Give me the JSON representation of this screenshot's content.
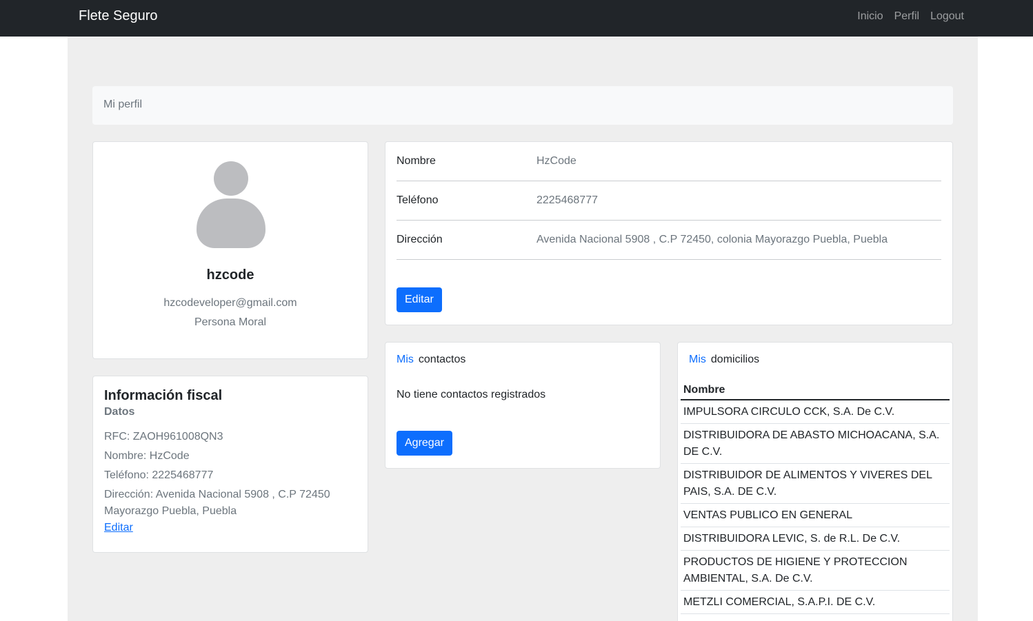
{
  "navbar": {
    "brand": "Flete Seguro",
    "links": [
      "Inicio",
      "Perfil",
      "Logout"
    ]
  },
  "breadcrumb": "Mi perfil",
  "profile": {
    "username": "hzcode",
    "email": "hzcodeveloper@gmail.com",
    "person_type": "Persona Moral",
    "avatar_icon": "user-avatar-icon"
  },
  "fiscal": {
    "title": "Información fiscal",
    "subtitle": "Datos",
    "rfc": "RFC: ZAOH961008QN3",
    "name": "Nombre: HzCode",
    "phone": "Teléfono: 2225468777",
    "address": "Dirección: Avenida Nacional 5908 , C.P 72450 Mayorazgo Puebla, Puebla",
    "edit_link": "Editar"
  },
  "details": {
    "rows": [
      {
        "label": "Nombre",
        "value": "HzCode"
      },
      {
        "label": "Teléfono",
        "value": "2225468777"
      },
      {
        "label": "Dirección",
        "value": "Avenida Nacional 5908 , C.P 72450, colonia Mayorazgo Puebla, Puebla"
      }
    ],
    "edit_button": "Editar"
  },
  "contacts": {
    "title_prefix": "Mis",
    "title": "contactos",
    "empty": "No tiene contactos registrados",
    "add_button": "Agregar"
  },
  "addresses": {
    "title_prefix": "Mis",
    "title": "domicilios",
    "column": "Nombre",
    "items": [
      "IMPULSORA CIRCULO CCK, S.A. De C.V.",
      "DISTRIBUIDORA DE ABASTO MICHOACANA, S.A. DE C.V.",
      "DISTRIBUIDOR DE ALIMENTOS Y VIVERES DEL PAIS, S.A. DE C.V.",
      "VENTAS PUBLICO EN GENERAL",
      "DISTRIBUIDORA LEVIC, S. de R.L. De C.V.",
      "PRODUCTOS DE HIGIENE Y PROTECCION AMBIENTAL, S.A. De C.V.",
      "METZLI COMERCIAL, S.A.P.I. DE C.V."
    ]
  },
  "colors": {
    "navbar": "#212529",
    "primary": "#0d6efd",
    "background": "#eeeeee"
  }
}
